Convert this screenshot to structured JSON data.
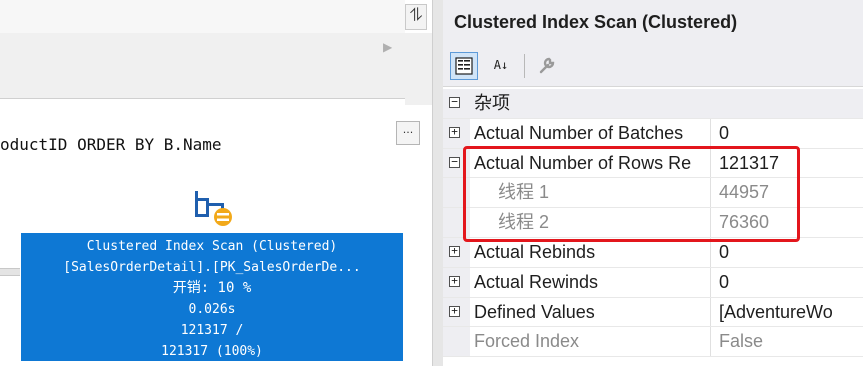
{
  "plan": {
    "splitter_glyph": "⥮",
    "scroll_arrow": "▶",
    "query_text": "oductID ORDER BY B.Name",
    "ellipsis_label": "...",
    "node": {
      "line1": "Clustered Index Scan (Clustered)",
      "line2": "[SalesOrderDetail].[PK_SalesOrderDe...",
      "line3": "开销: 10 %",
      "line4": "0.026s",
      "line5": "121317 /",
      "line6": "121317 (100%)"
    }
  },
  "properties": {
    "title": "Clustered Index Scan (Clustered)",
    "toolbar": {
      "categorized_icon": "categorized-icon",
      "alphabetical_icon": "alphabetical-sort-icon",
      "alphabetical_label": "A↓",
      "property_pages_icon": "wrench-icon"
    },
    "category": {
      "expander": "⊟",
      "label": "杂项"
    },
    "rows": [
      {
        "expander": "+",
        "name": "Actual Number of Batches",
        "value": "0"
      },
      {
        "expander": "−",
        "name": "Actual Number of Rows Re",
        "value": "121317"
      },
      {
        "expander": "",
        "name": "线程 1",
        "value": "44957"
      },
      {
        "expander": "",
        "name": "线程 2",
        "value": "76360"
      },
      {
        "expander": "+",
        "name": "Actual Rebinds",
        "value": "0"
      },
      {
        "expander": "+",
        "name": "Actual Rewinds",
        "value": "0"
      },
      {
        "expander": "+",
        "name": "Defined Values",
        "value": "[AdventureWo"
      },
      {
        "expander": "",
        "name": "Forced Index",
        "value": "False"
      }
    ]
  },
  "colors": {
    "node_fill": "#0e78d4",
    "highlight": "#e3161c",
    "panel_bg": "#eeeef2"
  }
}
